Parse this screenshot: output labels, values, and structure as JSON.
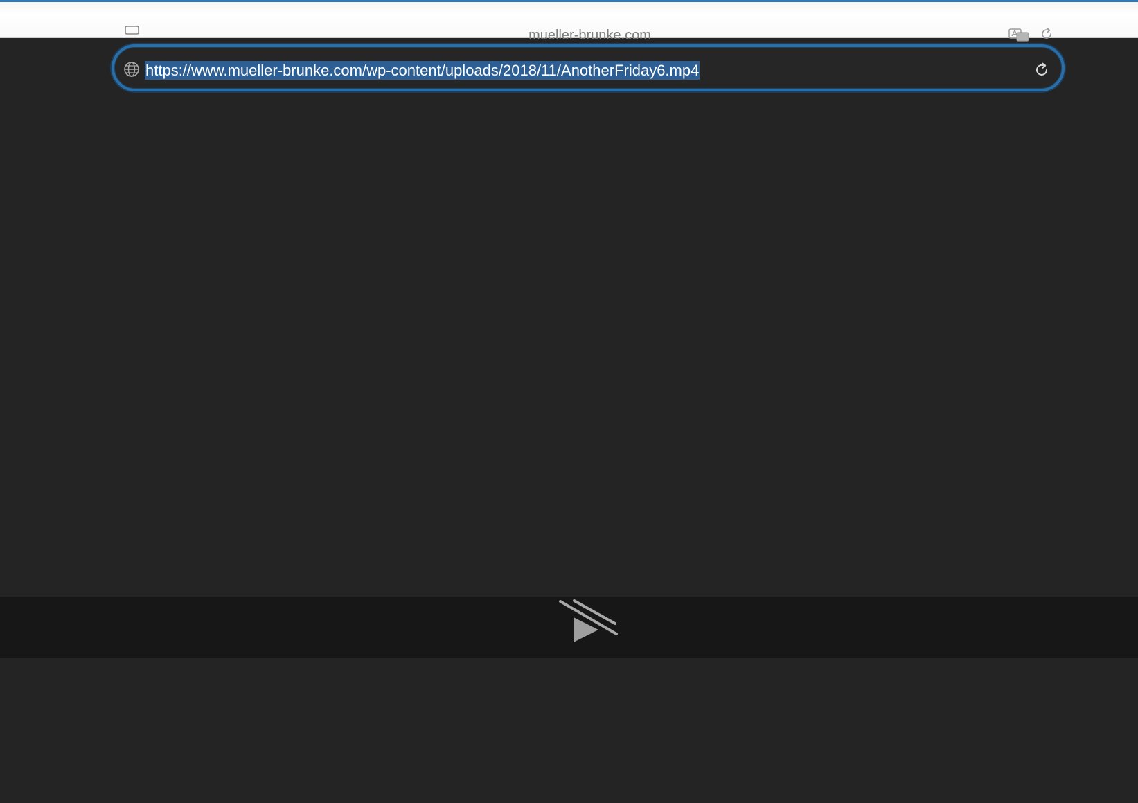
{
  "toolbar": {
    "domain": "mueller-brunke.com"
  },
  "address_bar": {
    "url": "https://www.mueller-brunke.com/wp-content/uploads/2018/11/AnotherFriday6.mp4",
    "url_selected": true
  },
  "icons": {
    "sidebar": "sidebar-icon",
    "translate": "translate-icon",
    "toolbar_reload": "reload-icon",
    "globe": "globe-icon",
    "address_reload": "reload-icon",
    "player": "play-disabled-icon"
  },
  "colors": {
    "focus_ring": "#2a6ea8",
    "selection": "#2d5f95",
    "page_background": "#242424",
    "controls_background": "#171717"
  }
}
